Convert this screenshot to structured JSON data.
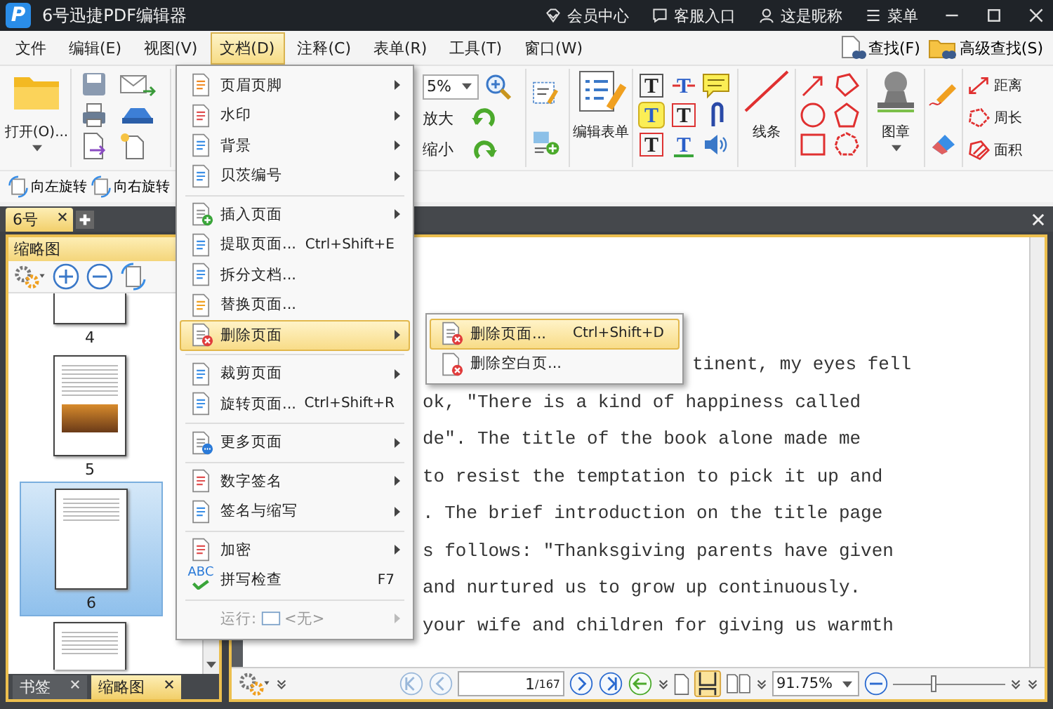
{
  "title_bar": {
    "logo": "P",
    "title": "6号迅捷PDF编辑器",
    "links": [
      {
        "kind": "vip",
        "label": "会员中心"
      },
      {
        "kind": "service",
        "label": "客服入口"
      },
      {
        "kind": "user",
        "label": "这是昵称"
      },
      {
        "kind": "menu",
        "label": "菜单"
      }
    ]
  },
  "menu_bar": {
    "items": [
      {
        "label": "文件",
        "selected": false
      },
      {
        "label": "编辑(E)",
        "selected": false
      },
      {
        "label": "视图(V)",
        "selected": false
      },
      {
        "label": "文档(D)",
        "selected": true
      },
      {
        "label": "注释(C)",
        "selected": false
      },
      {
        "label": "表单(R)",
        "selected": false
      },
      {
        "label": "工具(T)",
        "selected": false
      },
      {
        "label": "窗口(W)",
        "selected": false
      }
    ],
    "search_buttons": [
      {
        "kind": "find",
        "label": "查找(F)"
      },
      {
        "kind": "advanced",
        "label": "高级查找(S)"
      }
    ]
  },
  "ribbon": {
    "open_label": "打开(O)...",
    "zoom_value": "5%",
    "zoom_in": "放大",
    "zoom_out": "缩小",
    "form_edit": "编辑表单",
    "text_tools": [
      "T",
      "T",
      "T",
      "T",
      "T",
      "T"
    ],
    "line": "线条",
    "stamp": "图章",
    "measure": [
      "距离",
      "周长",
      "面积"
    ],
    "rotate_buttons": [
      "向左旋转",
      "向右旋转"
    ]
  },
  "doc_tabs": [
    {
      "label": "6号",
      "selected": true
    }
  ],
  "side_panel": {
    "title": "缩略图",
    "thumbnails": [
      {
        "kind": "cut",
        "label": "4",
        "selected": false
      },
      {
        "kind": "photo",
        "label": "5",
        "selected": false
      },
      {
        "kind": "text",
        "label": "6",
        "selected": true
      },
      {
        "kind": "partial",
        "selected": false
      }
    ],
    "tabs": [
      {
        "label": "书签",
        "selected": false
      },
      {
        "label": "缩略图",
        "selected": true
      }
    ]
  },
  "document": {
    "lines": [
      "tinent, my eyes fell",
      "ok, ″There is a kind of happiness called",
      "de″. The title of the book alone made me",
      "to resist the temptation to pick it up and",
      ". The brief introduction on the title page",
      "s follows: ″Thanksgiving parents have given",
      "and nurtured us to grow up continuously.",
      "your wife and children for giving us warmth"
    ]
  },
  "bottom_bar": {
    "page": "1",
    "page_count": "/167",
    "zoom": "91.75%",
    "zoom_slider": {
      "level": 0.36
    }
  },
  "doc_menu": {
    "items": [
      {
        "kind": "item",
        "label": "页眉页脚",
        "submenu": true,
        "selected": false
      },
      {
        "kind": "item",
        "label": "水印",
        "submenu": true,
        "selected": false
      },
      {
        "kind": "item",
        "label": "背景",
        "submenu": true,
        "selected": false
      },
      {
        "kind": "item",
        "label": "贝茨编号",
        "submenu": true,
        "selected": false
      },
      {
        "kind": "separator"
      },
      {
        "kind": "item",
        "label": "插入页面",
        "submenu": true,
        "selected": false
      },
      {
        "kind": "item",
        "label": "提取页面...",
        "shortcut": "Ctrl+Shift+E",
        "submenu": false,
        "selected": false
      },
      {
        "kind": "item",
        "label": "拆分文档...",
        "submenu": false,
        "selected": false
      },
      {
        "kind": "item",
        "label": "替换页面...",
        "submenu": false,
        "selected": false
      },
      {
        "kind": "item",
        "label": "删除页面",
        "submenu": true,
        "selected": true
      },
      {
        "kind": "separator"
      },
      {
        "kind": "item",
        "label": "裁剪页面",
        "submenu": true,
        "selected": false
      },
      {
        "kind": "item",
        "label": "旋转页面...",
        "shortcut": "Ctrl+Shift+R",
        "submenu": false,
        "selected": false
      },
      {
        "kind": "separator"
      },
      {
        "kind": "item",
        "label": "更多页面",
        "submenu": true,
        "selected": false
      },
      {
        "kind": "separator"
      },
      {
        "kind": "item",
        "label": "数字签名",
        "submenu": true,
        "selected": false
      },
      {
        "kind": "item",
        "label": "签名与缩写",
        "submenu": true,
        "selected": false
      },
      {
        "kind": "separator"
      },
      {
        "kind": "item",
        "label": "加密",
        "submenu": true,
        "selected": false
      },
      {
        "kind": "item",
        "label": "拼写检查",
        "icon_text": "ABC",
        "shortcut": "F7",
        "submenu": false,
        "selected": false
      },
      {
        "kind": "separator"
      },
      {
        "kind": "run",
        "label": "运行:",
        "value": "<无>",
        "submenu": true,
        "selected": false,
        "disabled": true
      }
    ]
  },
  "sub_menu": {
    "items": [
      {
        "label": "删除页面...",
        "shortcut": "Ctrl+Shift+D",
        "selected": true
      },
      {
        "label": "删除空白页...",
        "selected": false
      }
    ]
  }
}
